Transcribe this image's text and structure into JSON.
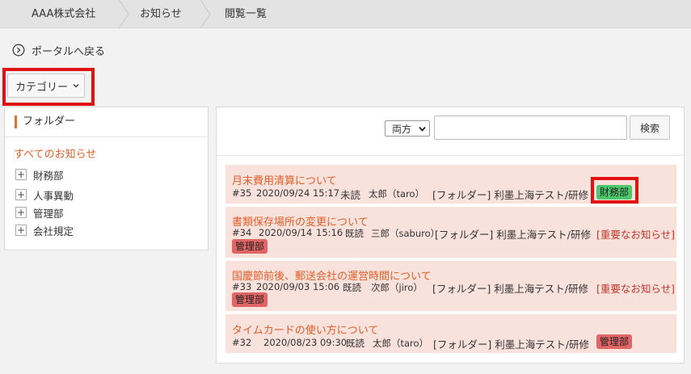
{
  "breadcrumb": {
    "company": "AAA株式会社",
    "notices": "お知らせ",
    "view_list": "閲覧一覧"
  },
  "back_link": "ポータルへ戻る",
  "category_button": "カテゴリー",
  "sidebar": {
    "title": "フォルダー",
    "all_notices": "すべてのお知らせ",
    "items": [
      "財務部",
      "人事異動",
      "管理部",
      "会社規定"
    ]
  },
  "search": {
    "scope": "両方",
    "value": "",
    "button": "検索"
  },
  "notices": [
    {
      "title": "月末費用清算について",
      "id": "#35",
      "date": "2020/09/24 15:17",
      "status": "未読",
      "author": "太郎（taro）",
      "folder": "[フォルダー] 利墨上海テスト/研修",
      "tag": "財務部",
      "tag_color": "#4cc86b"
    },
    {
      "title": "書類保存場所の変更について",
      "id": "#34",
      "date": "2020/09/14",
      "time": "15:16",
      "status": "既読",
      "author": "三郎（saburo）",
      "folder": "[フォルダー] 利墨上海テスト/研修",
      "important": "[重要なお知らせ]",
      "tag": "管理部",
      "tag_color": "#e16565"
    },
    {
      "title": "国慶節前後、郵送会社の運営時間について",
      "id": "#33",
      "date": "2020/09/03 15:06",
      "status": "既読",
      "author": "次郎（jiro）",
      "folder": "[フォルダー] 利墨上海テスト/研修",
      "important": "[重要なお知らせ]",
      "tag": "管理部",
      "tag_color": "#e16565"
    },
    {
      "title": "タイムカードの使い方について",
      "id": "#32",
      "date": "2020/08/23 09:30",
      "status": "既読",
      "author": "太郎（taro）",
      "folder": "[フォルダー] 利墨上海テスト/研修",
      "tag": "管理部",
      "tag_color": "#e16565"
    }
  ],
  "colors": {
    "accent": "#e0602a",
    "highlight": "#e01212",
    "item_bg": "#f9e1dc"
  },
  "icons": {
    "back": "circle-chevron-right-icon",
    "category_chevron": "chevron-down-icon",
    "tree_expand": "plus-icon",
    "select_arrow": "chevron-down-icon"
  }
}
